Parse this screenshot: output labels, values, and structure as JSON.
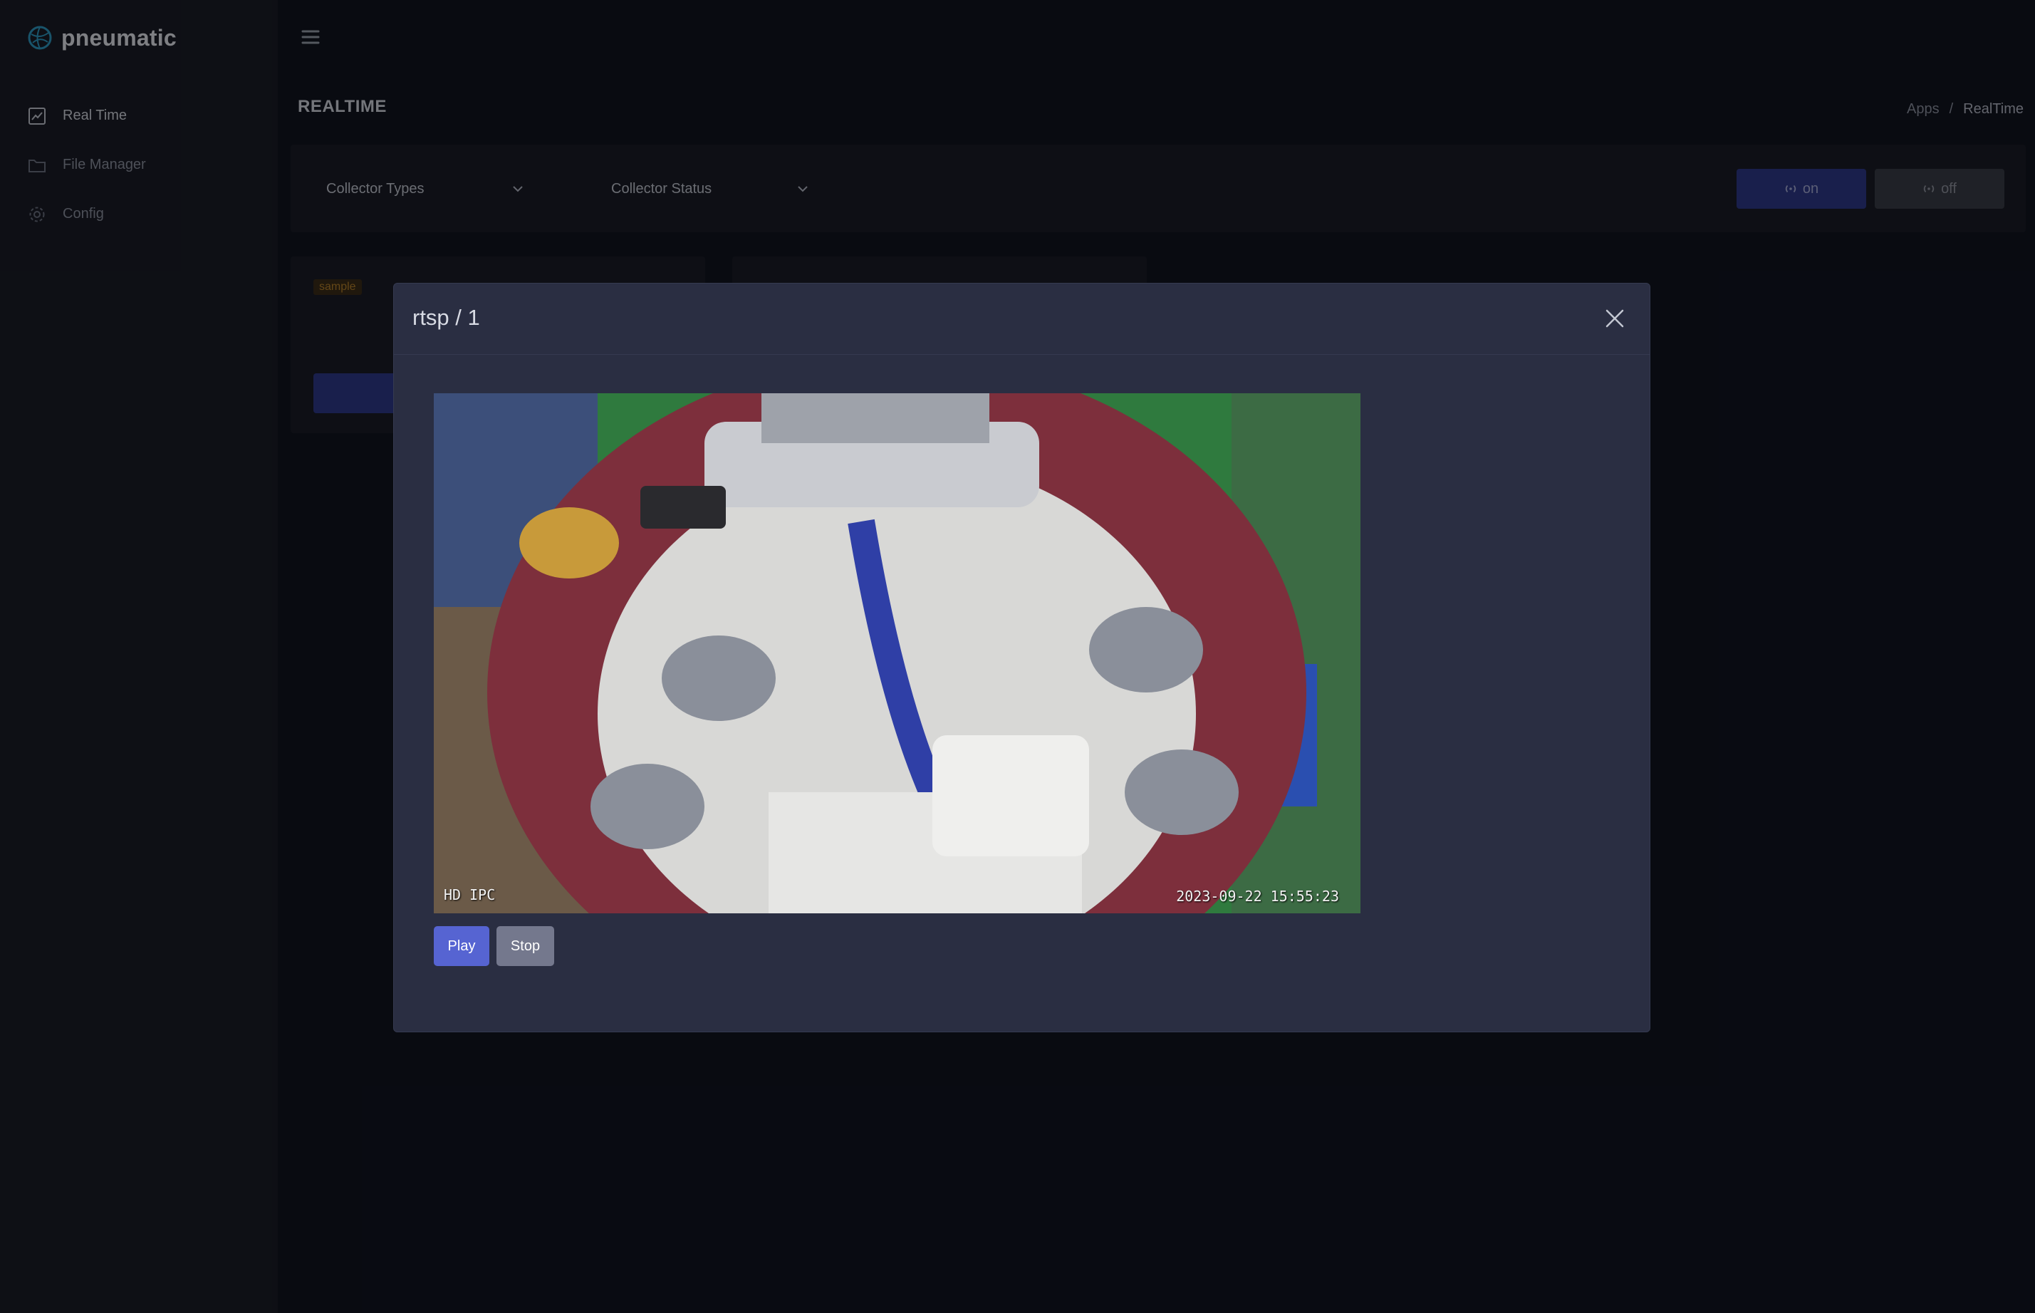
{
  "brand": {
    "name": "pneumatic",
    "logo_icon": "globe-icon"
  },
  "sidebar": {
    "items": [
      {
        "label": "Real Time",
        "icon": "chart-line-icon",
        "active": true
      },
      {
        "label": "File Manager",
        "icon": "folder-icon",
        "active": false
      },
      {
        "label": "Config",
        "icon": "gear-icon",
        "active": false
      }
    ]
  },
  "header": {
    "title": "REALTIME"
  },
  "breadcrumb": {
    "root": "Apps",
    "separator": "/",
    "current": "RealTime"
  },
  "filters": {
    "collector_types": "Collector Types",
    "collector_status": "Collector Status"
  },
  "toggle": {
    "on_label": "on",
    "off_label": "off"
  },
  "cards": [
    {
      "tag": "sample"
    }
  ],
  "modal": {
    "title": "rtsp / 1",
    "video": {
      "overlay_left": "HD IPC",
      "overlay_timestamp": "2023-09-22 15:55:23"
    },
    "play_label": "Play",
    "stop_label": "Stop"
  },
  "colors": {
    "accent": "#5664d2",
    "accent_dark": "#2e3a8a",
    "background": "#111420",
    "surface": "#1a1d27",
    "modal": "#2a2e42",
    "tag": "#b4802b"
  }
}
